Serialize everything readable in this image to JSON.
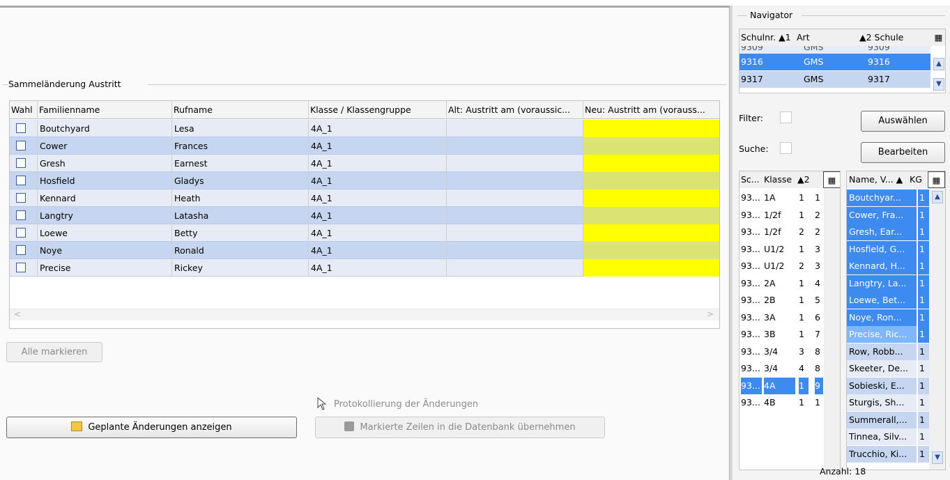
{
  "left": {
    "group_title": "Sammeländerung Austritt",
    "columns": [
      "Wahl",
      "Familienname",
      "Rufname",
      "Klasse / Klassengruppe",
      "Alt: Austritt am (voraussic...",
      "Neu: Austritt am (vorauss..."
    ],
    "rows": [
      {
        "familienname": "Boutchyard",
        "rufname": "Lesa",
        "klasse": "4A_1",
        "alt": "",
        "neu": ""
      },
      {
        "familienname": "Cower",
        "rufname": "Frances",
        "klasse": "4A_1",
        "alt": "",
        "neu": ""
      },
      {
        "familienname": "Gresh",
        "rufname": "Earnest",
        "klasse": "4A_1",
        "alt": "",
        "neu": ""
      },
      {
        "familienname": "Hosfield",
        "rufname": "Gladys",
        "klasse": "4A_1",
        "alt": "",
        "neu": ""
      },
      {
        "familienname": "Kennard",
        "rufname": "Heath",
        "klasse": "4A_1",
        "alt": "",
        "neu": ""
      },
      {
        "familienname": "Langtry",
        "rufname": "Latasha",
        "klasse": "4A_1",
        "alt": "",
        "neu": ""
      },
      {
        "familienname": "Loewe",
        "rufname": "Betty",
        "klasse": "4A_1",
        "alt": "",
        "neu": ""
      },
      {
        "familienname": "Noye",
        "rufname": "Ronald",
        "klasse": "4A_1",
        "alt": "",
        "neu": ""
      },
      {
        "familienname": "Precise",
        "rufname": "Rickey",
        "klasse": "4A_1",
        "alt": "",
        "neu": ""
      }
    ],
    "scroll_left_glyph": "<",
    "scroll_right_glyph": ">",
    "mark_all_label": "Alle markieren",
    "show_changes_label": "Geplante Änderungen anzeigen",
    "protocol_label": "Protokollierung der Änderungen",
    "apply_label": "Markierte Zeilen in die Datenbank übernehmen",
    "colors": {
      "row_odd": "#e6ebf5",
      "row_even": "#c6d6f1",
      "yellow": "#ffff00",
      "olive": "#d9e472"
    }
  },
  "navigator": {
    "title": "Navigator",
    "columns": [
      "Schulnr. ▲1",
      "Art",
      "▲2 Schule"
    ],
    "partial_row": [
      "9309",
      "GMS",
      "9309"
    ],
    "rows": [
      {
        "schulnr": "9316",
        "art": "GMS",
        "schule": "9316",
        "selected": true
      },
      {
        "schulnr": "9317",
        "art": "GMS",
        "schule": "9317",
        "selected": false
      }
    ],
    "filter_label": "Filter:",
    "suche_label": "Suche:",
    "auswaehlen_label": "Auswählen",
    "bearbeiten_label": "Bearbeiten",
    "class_columns": [
      "Sc...",
      "Klasse",
      "▲2"
    ],
    "classes": [
      {
        "sc": "93...",
        "klasse": "1A",
        "a": "1",
        "b": "1",
        "selected": false
      },
      {
        "sc": "93...",
        "klasse": "1/2f",
        "a": "1",
        "b": "2",
        "selected": false
      },
      {
        "sc": "93...",
        "klasse": "1/2f",
        "a": "2",
        "b": "2",
        "selected": false
      },
      {
        "sc": "93...",
        "klasse": "U1/2",
        "a": "1",
        "b": "3",
        "selected": false
      },
      {
        "sc": "93...",
        "klasse": "U1/2",
        "a": "2",
        "b": "3",
        "selected": false
      },
      {
        "sc": "93...",
        "klasse": "2A",
        "a": "1",
        "b": "4",
        "selected": false
      },
      {
        "sc": "93...",
        "klasse": "2B",
        "a": "1",
        "b": "5",
        "selected": false
      },
      {
        "sc": "93...",
        "klasse": "3A",
        "a": "1",
        "b": "6",
        "selected": false
      },
      {
        "sc": "93...",
        "klasse": "3B",
        "a": "1",
        "b": "7",
        "selected": false
      },
      {
        "sc": "93...",
        "klasse": "3/4",
        "a": "3",
        "b": "8",
        "selected": false
      },
      {
        "sc": "93...",
        "klasse": "3/4",
        "a": "4",
        "b": "8",
        "selected": false
      },
      {
        "sc": "93...",
        "klasse": "4A",
        "a": "1",
        "b": "9",
        "selected": true
      },
      {
        "sc": "93...",
        "klasse": "4B",
        "a": "1",
        "b": "1",
        "selected": false
      }
    ],
    "student_columns": [
      "Name, V... ▲",
      "KG"
    ],
    "students": [
      {
        "name": "Boutchyar...",
        "kg": "1",
        "state": "sel"
      },
      {
        "name": "Cower, Fra...",
        "kg": "1",
        "state": "sel"
      },
      {
        "name": "Gresh, Ear...",
        "kg": "1",
        "state": "sel"
      },
      {
        "name": "Hosfield, G...",
        "kg": "1",
        "state": "sel"
      },
      {
        "name": "Kennard, H...",
        "kg": "1",
        "state": "sel"
      },
      {
        "name": "Langtry, La...",
        "kg": "1",
        "state": "sel"
      },
      {
        "name": "Loewe, Bet...",
        "kg": "1",
        "state": "sel"
      },
      {
        "name": "Noye, Ron...",
        "kg": "1",
        "state": "sel"
      },
      {
        "name": "Precise, Ric...",
        "kg": "1",
        "state": "focus"
      },
      {
        "name": "Row, Robb...",
        "kg": "1",
        "state": "none"
      },
      {
        "name": "Skeeter, De...",
        "kg": "1",
        "state": "none"
      },
      {
        "name": "Sobieski, E...",
        "kg": "1",
        "state": "none"
      },
      {
        "name": "Sturgis, Sh...",
        "kg": "1",
        "state": "none"
      },
      {
        "name": "Summerall,...",
        "kg": "1",
        "state": "none"
      },
      {
        "name": "Tinnea, Silv...",
        "kg": "1",
        "state": "none"
      },
      {
        "name": "Trucchio, Ki...",
        "kg": "1",
        "state": "none"
      }
    ],
    "anzahl": "Anzahl: 18"
  }
}
